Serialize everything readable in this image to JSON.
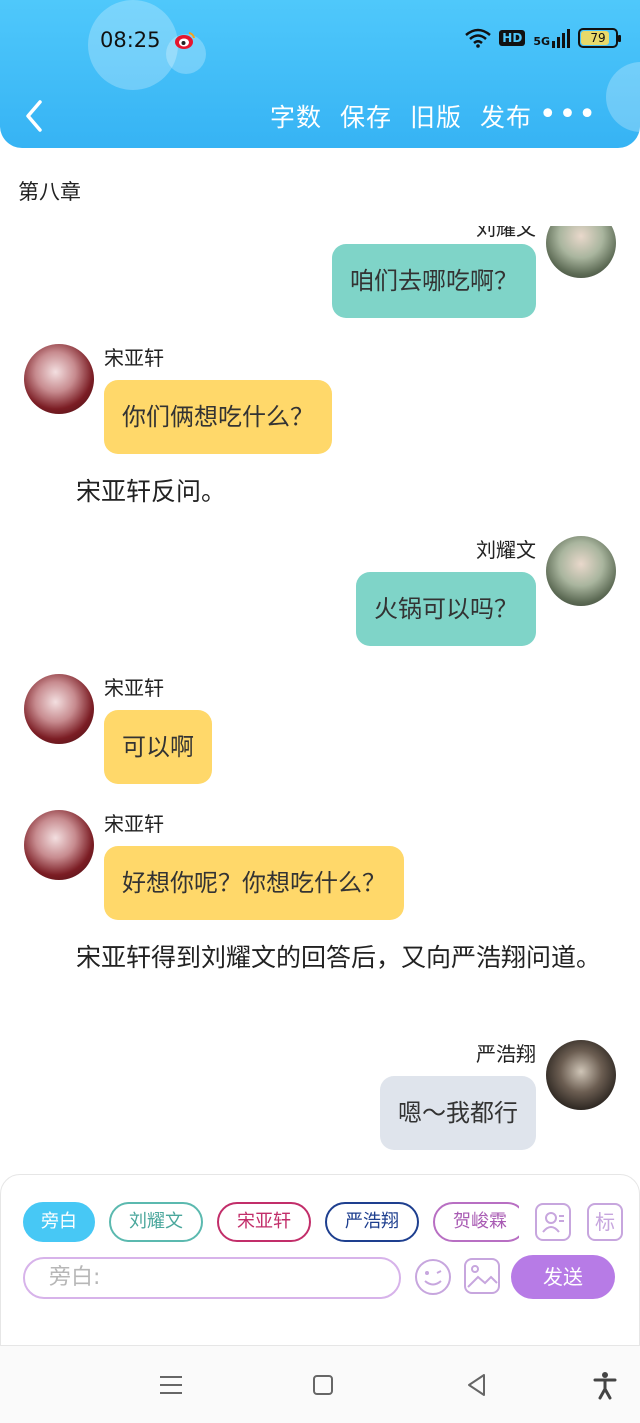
{
  "status_bar": {
    "time": "08:25",
    "network": "5G",
    "hd": "HD",
    "battery": "79",
    "icons": [
      "weibo-icon",
      "wifi-icon",
      "hd-icon",
      "signal-5g-icon",
      "battery-icon"
    ]
  },
  "header": {
    "back_icon": "chevron-left-icon",
    "actions": [
      "字数",
      "保存",
      "旧版",
      "发布"
    ],
    "more": "•••",
    "background": "#3cb8f6"
  },
  "chapter_title": "第八章",
  "messages": [
    {
      "type": "right",
      "speaker": "刘耀文",
      "text": "咱们去哪吃啊？",
      "color": "#7fd4c8"
    },
    {
      "type": "left",
      "speaker": "宋亚轩",
      "text": "你们俩想吃什么？",
      "color": "#ffd86a"
    },
    {
      "type": "narration",
      "text": "宋亚轩反问。"
    },
    {
      "type": "right",
      "speaker": "刘耀文",
      "text": "火锅可以吗？",
      "color": "#7fd4c8"
    },
    {
      "type": "left",
      "speaker": "宋亚轩",
      "text": "可以啊",
      "color": "#ffd86a"
    },
    {
      "type": "left",
      "speaker": "宋亚轩",
      "text": "好想你呢？你想吃什么？",
      "color": "#ffd86a"
    },
    {
      "type": "narration",
      "text": "宋亚轩得到刘耀文的回答后，又向严浩翔问道。"
    },
    {
      "type": "right",
      "speaker": "严浩翔",
      "text": "嗯～我都行",
      "color": "#dfe4ec"
    }
  ],
  "composer": {
    "roles": [
      "旁白",
      "刘耀文",
      "宋亚轩",
      "严浩翔",
      "贺峻霖"
    ],
    "role_icon": "person-card-icon",
    "mark_label": "标",
    "input_placeholder": "旁白:",
    "emoji_icon": "emoji-icon",
    "image_icon": "image-icon",
    "send_label": "发送",
    "accent": "#b77be6"
  },
  "system_nav": [
    "menu-icon",
    "home-square-icon",
    "back-triangle-icon",
    "accessibility-icon"
  ]
}
